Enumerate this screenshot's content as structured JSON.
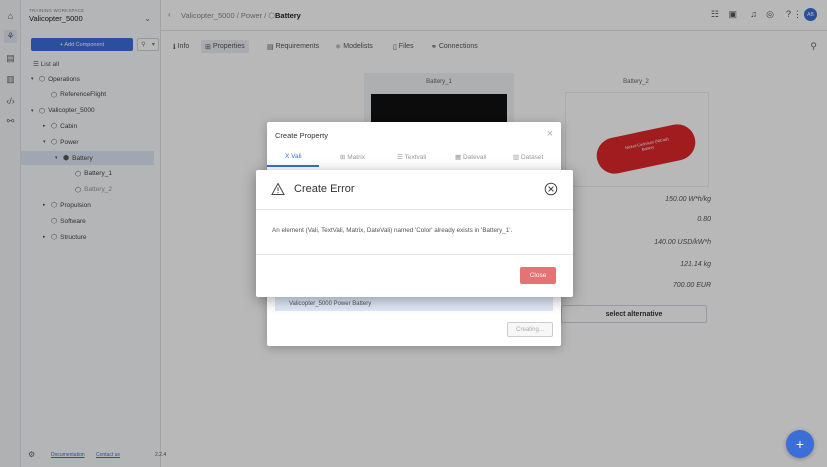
{
  "workspace": {
    "label": "TRAINING WORKSPACE",
    "name": "Valicopter_5000"
  },
  "sidebar": {
    "add_component": "+ Add Component",
    "list_all": "List all",
    "tree": [
      {
        "label": "Operations",
        "depth": 0,
        "arrow": "▾"
      },
      {
        "label": "ReferenceFlight",
        "depth": 1,
        "arrow": ""
      },
      {
        "label": "Valicopter_5000",
        "depth": 0,
        "arrow": "▾"
      },
      {
        "label": "Cabin",
        "depth": 1,
        "arrow": "▸"
      },
      {
        "label": "Power",
        "depth": 1,
        "arrow": "▾"
      },
      {
        "label": "Battery",
        "depth": 2,
        "arrow": "▾"
      },
      {
        "label": "Battery_1",
        "depth": 3,
        "arrow": ""
      },
      {
        "label": "Battery_2",
        "depth": 3,
        "arrow": ""
      },
      {
        "label": "Propulsion",
        "depth": 1,
        "arrow": "▸"
      },
      {
        "label": "Software",
        "depth": 1,
        "arrow": ""
      },
      {
        "label": "Structure",
        "depth": 1,
        "arrow": "▸"
      }
    ],
    "footer": {
      "documentation": "Documentation",
      "contact": "Contact us",
      "version": "2.2.4"
    }
  },
  "header": {
    "breadcrumb_prefix": "Valicopter_5000 / Power /",
    "breadcrumb_current": "Battery",
    "avatar": "AB"
  },
  "tabs": [
    "Info",
    "Properties",
    "Requirements",
    "Modelists",
    "Files",
    "Connections"
  ],
  "main": {
    "alt1": "Battery_1",
    "alt2": "Battery_2",
    "battery_label": "Nickel-Cadmium (NiCad) Battery",
    "values": [
      "150.00 W*h/kg",
      "0.80",
      "140.00 USD/kW*h",
      "121.14 kg",
      "700.00 EUR"
    ],
    "select_alternative": "select alternative"
  },
  "create_property": {
    "title": "Create Property",
    "tabs": [
      "Vali",
      "Matrix",
      "Textvali",
      "Datevali",
      "Dataset"
    ],
    "field_value": "Valicopter_5000 Power Battery",
    "button": "Creating..."
  },
  "error_dialog": {
    "title": "Create Error",
    "message": "An element (Vali, TextVali, Matrix, DateVali) named 'Color' already exists in 'Battery_1'.",
    "close": "Close"
  },
  "colors": {
    "accent": "#3b6ed8",
    "danger": "#e57373"
  }
}
